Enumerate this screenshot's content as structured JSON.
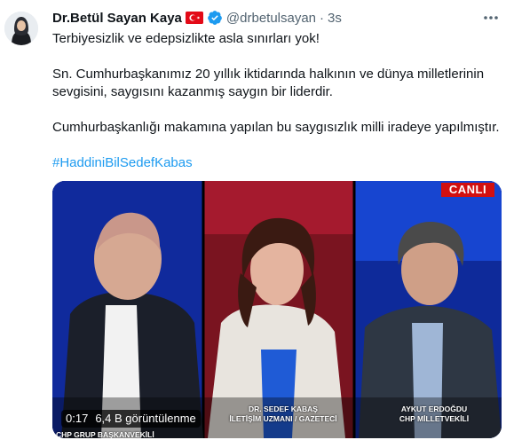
{
  "author": {
    "display_name": "Dr.Betül Sayan Kaya",
    "handle": "@drbetulsayan",
    "separator": "·",
    "timestamp": "3s"
  },
  "tweet": {
    "line1": "Terbiyesizlik ve edepsizlikte asla sınırları yok!",
    "line2": "Sn. Cumhurbaşkanımız 20 yıllık iktidarında halkının ve dünya milletlerinin",
    "line3": "sevgisini, saygısını kazanmış saygın bir liderdir.",
    "line4": "Cumhurbaşkanlığı makamına yapılan bu saygısızlık milli iradeye yapılmıştır.",
    "hashtag": "#HaddiniBilSedefKabas"
  },
  "media": {
    "live_badge": "CANLI",
    "caption_center_name": "DR. SEDEF KABAŞ",
    "caption_center_title": "İLETİŞİM UZMANI / GAZETECİ",
    "caption_right_name": "AYKUT ERDOĞDU",
    "caption_right_title": "CHP MİLLETVEKİLİ",
    "caption_left_title": "CHP GRUP BAŞKANVEKİLİ",
    "elapsed": "0:17",
    "views": "6,4 B görüntülenme"
  },
  "icons": {
    "flag": "turkey-flag-icon",
    "verified": "verified-badge-icon",
    "more": "more-options-icon"
  },
  "colors": {
    "link": "#1d9bf0",
    "muted": "#536471",
    "live_red": "#d21010"
  }
}
